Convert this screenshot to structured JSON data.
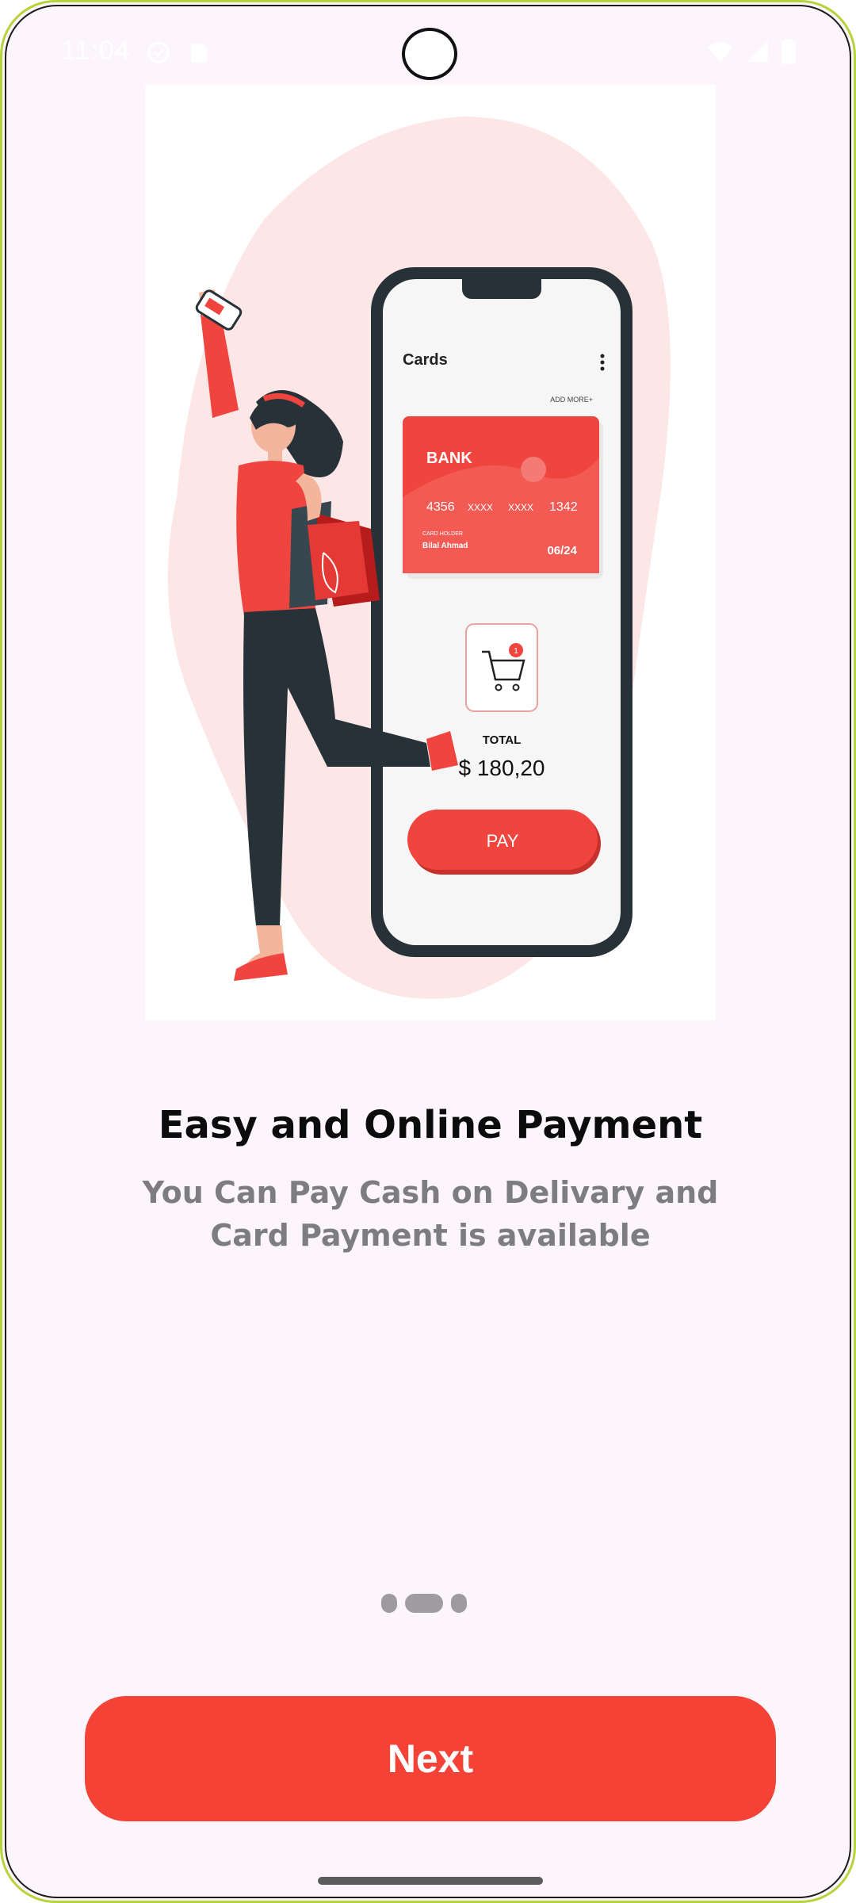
{
  "status_bar": {
    "time": "11:04",
    "left_icons": [
      "shield-icon",
      "sim-card-icon"
    ],
    "right_icons": [
      "wifi-icon",
      "signal-icon",
      "battery-icon"
    ]
  },
  "illustration": {
    "phone_header": "Cards",
    "add_more": "ADD MORE+",
    "card": {
      "bank": "BANK",
      "number_groups": [
        "4356",
        "XXXX",
        "XXXX",
        "1342"
      ],
      "holder_label": "CARD HOLDER",
      "holder_name": "Bilal Ahmad",
      "expiry": "06/24"
    },
    "cart_badge": "1",
    "total_label": "TOTAL",
    "total_amount": "$ 180,20",
    "pay_label": "PAY"
  },
  "onboarding": {
    "title": "Easy and Online Payment",
    "subtitle": "You Can Pay Cash on Delivary and Card Payment is available",
    "page_count": 3,
    "current_page": 2
  },
  "actions": {
    "next_label": "Next"
  },
  "colors": {
    "accent": "#f44336",
    "background": "#fcf5fb",
    "title_text": "#0c0c0c",
    "subtitle_text": "#7d7d80",
    "indicator": "#9e9b9e"
  }
}
